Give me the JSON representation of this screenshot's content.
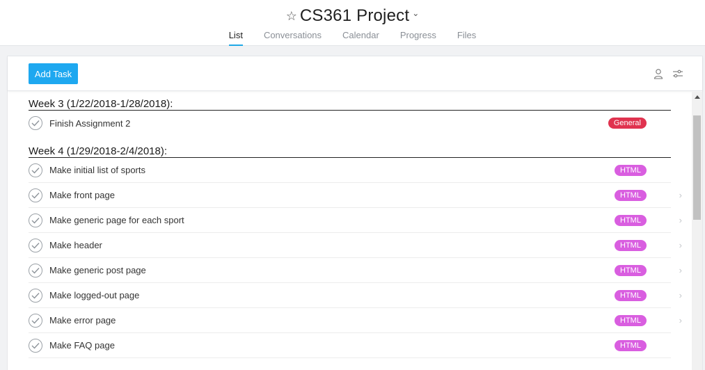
{
  "header": {
    "title": "CS361 Project",
    "tabs": [
      {
        "label": "List",
        "active": true
      },
      {
        "label": "Conversations",
        "active": false
      },
      {
        "label": "Calendar",
        "active": false
      },
      {
        "label": "Progress",
        "active": false
      },
      {
        "label": "Files",
        "active": false
      }
    ]
  },
  "toolbar": {
    "add_task_label": "Add Task"
  },
  "colors": {
    "accent": "#1ea8f0",
    "general_badge": "#e0334f",
    "html_badge": "#d95ee0"
  },
  "groups": [
    {
      "title": "Week 3 (1/22/2018-1/28/2018):",
      "tasks": [
        {
          "label": "Finish Assignment 2",
          "tag": "General"
        }
      ]
    },
    {
      "title": "Week 4 (1/29/2018-2/4/2018):",
      "tasks": [
        {
          "label": "Make initial list of sports",
          "tag": "HTML"
        },
        {
          "label": "Make front page",
          "tag": "HTML"
        },
        {
          "label": "Make generic page for each sport",
          "tag": "HTML"
        },
        {
          "label": "Make header",
          "tag": "HTML"
        },
        {
          "label": "Make generic post page",
          "tag": "HTML"
        },
        {
          "label": "Make logged-out page",
          "tag": "HTML"
        },
        {
          "label": "Make error page",
          "tag": "HTML"
        },
        {
          "label": "Make FAQ page",
          "tag": "HTML"
        }
      ]
    }
  ]
}
